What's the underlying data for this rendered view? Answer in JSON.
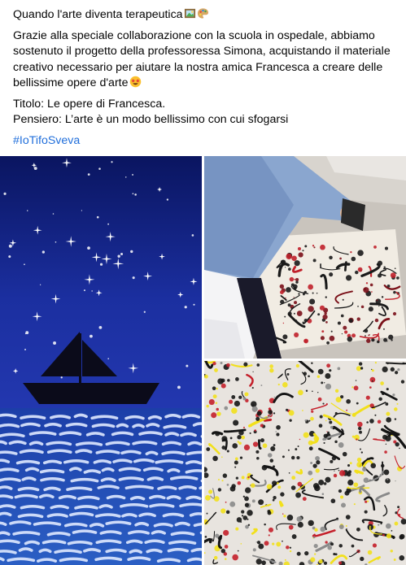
{
  "post": {
    "title": "Quando l'arte diventa terapeutica",
    "title_emojis": [
      "framed-picture-icon",
      "artist-palette-icon"
    ],
    "body": "Grazie alla speciale collaborazione con la scuola in ospedale, abbiamo sostenuto il progetto della professoressa Simona, acquistando il materiale creativo necessario per aiutare la nostra amica Francesca a creare delle bellissime opere d'arte",
    "body_emoji": "star-struck-emoji-icon",
    "titolo": "Titolo: Le opere di Francesca.",
    "pensiero": "Pensiero: L’arte è un modo bellissimo con cui sfogarsi",
    "hashtag": "#IoTifoSveva"
  },
  "photos": [
    {
      "subject": "painting-night-sky-boat"
    },
    {
      "subject": "child-splatter-painting"
    },
    {
      "subject": "splatter-painting-closeup"
    }
  ],
  "colors": {
    "hashtag": "#216fdb",
    "text": "#050505"
  }
}
